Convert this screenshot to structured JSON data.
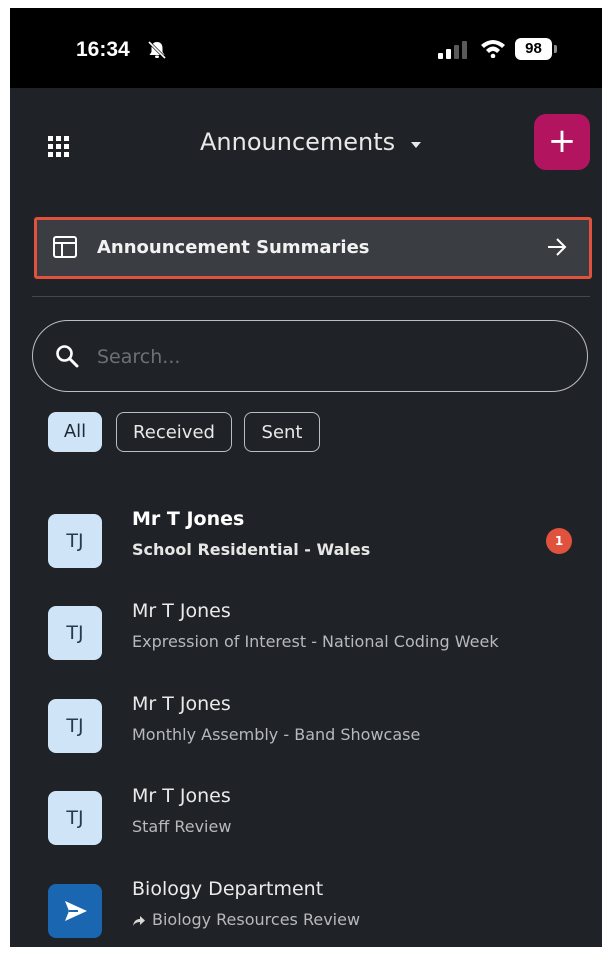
{
  "status_bar": {
    "time": "16:34",
    "battery": "98"
  },
  "header": {
    "title": "Announcements",
    "add_label": "+"
  },
  "summaries": {
    "label": "Announcement Summaries"
  },
  "search": {
    "placeholder": "Search...",
    "value": ""
  },
  "filters": {
    "all": "All",
    "received": "Received",
    "sent": "Sent",
    "selected": "All"
  },
  "announcements": [
    {
      "initials": "TJ",
      "sender": "Mr T Jones",
      "subject": "School Residential - Wales",
      "unread_count": "1"
    },
    {
      "initials": "TJ",
      "sender": "Mr T Jones",
      "subject": "Expression of Interest - National Coding Week"
    },
    {
      "initials": "TJ",
      "sender": "Mr T Jones",
      "subject": "Monthly Assembly - Band Showcase"
    },
    {
      "initials": "TJ",
      "sender": "Mr T Jones",
      "subject": "Staff Review"
    },
    {
      "sender": "Biology Department",
      "subject": "Biology Resources Review",
      "icon": "send-icon"
    }
  ],
  "colors": {
    "background": "#1f2226",
    "accent": "#b3145f",
    "highlight_border": "#e0523d",
    "avatar_bg": "#cfe5f7",
    "chip_active": "#cfe5f7"
  }
}
